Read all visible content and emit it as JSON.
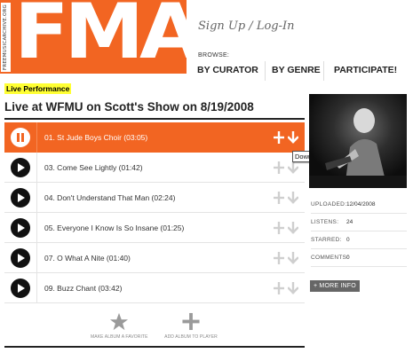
{
  "header": {
    "logo_text": "FMA",
    "logo_vertical_text": "FREEMUSICARCHIVE.ORG",
    "signup_label": "Sign Up / Log-In",
    "browse_label": "BROWSE:",
    "nav": [
      {
        "label": "BY CURATOR"
      },
      {
        "label": "BY GENRE"
      },
      {
        "label": "PARTICIPATE!"
      }
    ]
  },
  "album": {
    "tag": "Live Performance",
    "title": "Live at WFMU on Scott's Show on 8/19/2008",
    "tracks": [
      {
        "label": "01. St Jude Boys Choir (03:05)",
        "state": "playing"
      },
      {
        "label": "03. Come See Lightly (01:42)",
        "state": "idle"
      },
      {
        "label": "04. Don't Understand That Man (02:24)",
        "state": "idle"
      },
      {
        "label": "05. Everyone I Know Is So Insane (01:25)",
        "state": "idle"
      },
      {
        "label": "07. O What A Nite (01:40)",
        "state": "idle"
      },
      {
        "label": "09. Buzz Chant (03:42)",
        "state": "idle"
      }
    ],
    "tooltip": "Download",
    "actions": {
      "favorite_label": "MAKE ALBUM A FAVORITE",
      "add_label": "ADD ALBUM TO PLAYER"
    }
  },
  "sidebar": {
    "meta": [
      {
        "key": "UPLOADED:",
        "value": "12/04/2008"
      },
      {
        "key": "LISTENS:",
        "value": "24"
      },
      {
        "key": "STARRED:",
        "value": "0"
      },
      {
        "key": "COMMENTS:",
        "value": "0"
      }
    ],
    "more_info_label": "+ MORE INFO"
  },
  "colors": {
    "brand_orange": "#f26522",
    "highlight_yellow": "#ffff33"
  }
}
